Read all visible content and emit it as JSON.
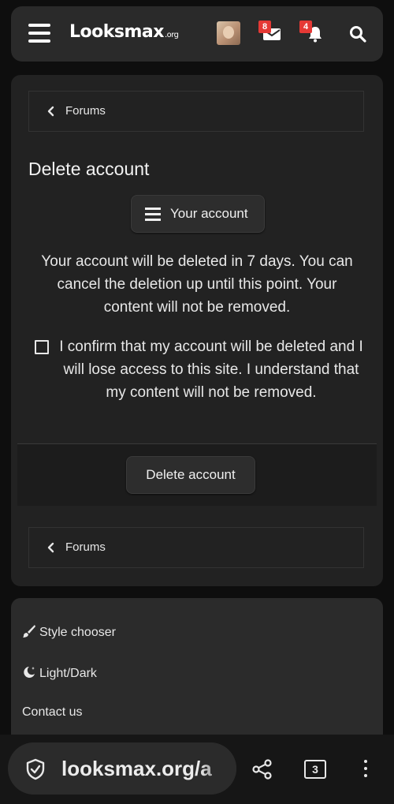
{
  "header": {
    "logo_main": "Looksmax",
    "logo_suffix": ".org",
    "messages_count": "8",
    "alerts_count": "4"
  },
  "breadcrumb": {
    "label": "Forums"
  },
  "page": {
    "title": "Delete account",
    "account_menu_label": "Your account",
    "notice": "Your account will be deleted in 7 days. You can cancel the deletion up until this point. Your content will not be removed.",
    "confirm_text": "I confirm that my account will be deleted and I will lose access to this site. I understand that my content will not be removed.",
    "confirm_checked": false,
    "delete_button": "Delete account"
  },
  "footer": {
    "style_chooser": "Style chooser",
    "light_dark": "Light/Dark",
    "contact_us": "Contact us"
  },
  "browser": {
    "url": "looksmax.org/a",
    "tab_count": "3"
  },
  "colors": {
    "background": "#0e0e0e",
    "panel": "#222222",
    "badge": "#e53935"
  }
}
